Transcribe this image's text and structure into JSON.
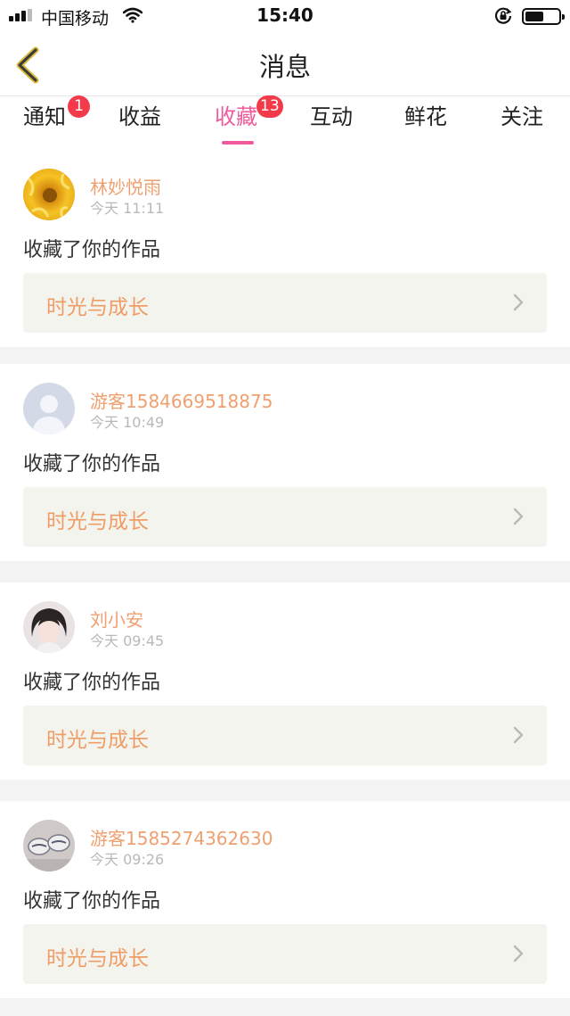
{
  "status_bar": {
    "carrier": "中国移动",
    "time": "15:40",
    "battery_level": 0.55
  },
  "nav": {
    "title": "消息",
    "back_icon": "chevron-left-icon"
  },
  "tabs": [
    {
      "label": "通知",
      "badge": "1"
    },
    {
      "label": "收益",
      "badge": ""
    },
    {
      "label": "收藏",
      "badge": "13",
      "active": true
    },
    {
      "label": "互动",
      "badge": ""
    },
    {
      "label": "鲜花",
      "badge": ""
    },
    {
      "label": "关注",
      "badge": ""
    }
  ],
  "messages": [
    {
      "user": "林妙悦雨",
      "time": "今天 11:11",
      "action": "收藏了你的作品",
      "work": "时光与成长",
      "avatar": "sunflower-avatar"
    },
    {
      "user": "游客1584669518875",
      "time": "今天 10:49",
      "action": "收藏了你的作品",
      "work": "时光与成长",
      "avatar": "default-user-avatar"
    },
    {
      "user": "刘小安",
      "time": "今天 09:45",
      "action": "收藏了你的作品",
      "work": "时光与成长",
      "avatar": "portrait-avatar"
    },
    {
      "user": "游客1585274362630",
      "time": "今天 09:26",
      "action": "收藏了你的作品",
      "work": "时光与成长",
      "avatar": "photo-avatar"
    }
  ],
  "colors": {
    "accent": "#ef5a9b",
    "badge": "#f33a4a",
    "username": "#f0a070",
    "work_title": "#ee9d67"
  }
}
